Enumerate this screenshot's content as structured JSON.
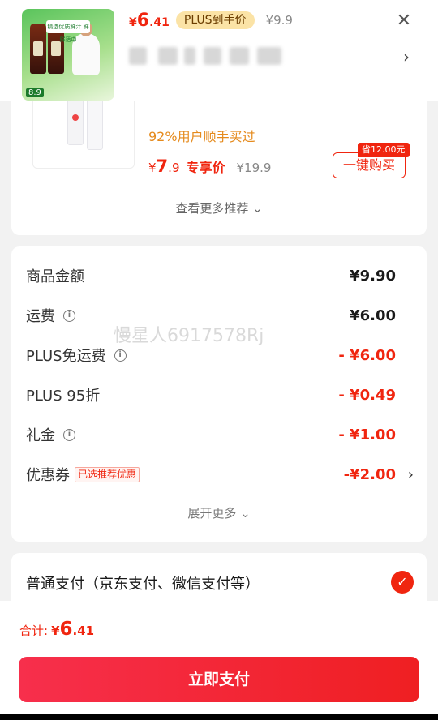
{
  "header": {
    "price_symbol": "¥",
    "price_int": "6",
    "price_dec": ".41",
    "plus_tag": "PLUS到手价",
    "original_price": "¥9.9",
    "close_icon": "✕",
    "chevron": "›",
    "thumb_promo": "精选优质鲜汁 鲜鲜适中",
    "thumb_price": "8.9"
  },
  "recommendation": {
    "sold_text": "92%用户顺手买过",
    "price_symbol": "¥",
    "price_int": "7",
    "price_dec": ".9",
    "price_label": "专享价",
    "original_price": "¥19.9",
    "save_badge": "省12.00元",
    "buy_button": "一键购买",
    "more_link": "查看更多推荐 ⌄"
  },
  "fees": {
    "rows": [
      {
        "label": "商品金额",
        "value": "¥9.90",
        "info": false
      },
      {
        "label": "运费",
        "value": "¥6.00",
        "info": true
      },
      {
        "label": "PLUS免运费",
        "value": "- ¥6.00",
        "info": true
      },
      {
        "label": "PLUS 95折",
        "value": "- ¥0.49",
        "info": false
      },
      {
        "label": "礼金",
        "value": "- ¥1.00",
        "info": true
      },
      {
        "label": "优惠券",
        "value": "-¥2.00",
        "info": false
      }
    ],
    "coupon_tag": "已选推荐优惠",
    "coupon_arrow": "›",
    "expand_more": "展开更多 ⌄",
    "info_icon": "i"
  },
  "watermark": "慢星人6917578Rj",
  "payment": {
    "method_label": "普通支付（京东支付、微信支付等）",
    "check_icon": "✓"
  },
  "footer": {
    "total_label": "合计:",
    "total_symbol": "¥",
    "total_int": "6",
    "total_dec": ".41",
    "pay_button": "立即支付"
  },
  "colors": {
    "accent": "#f0250f",
    "plus_tag_bg": "#fbe3a6",
    "sold_text": "#e58a1c"
  }
}
